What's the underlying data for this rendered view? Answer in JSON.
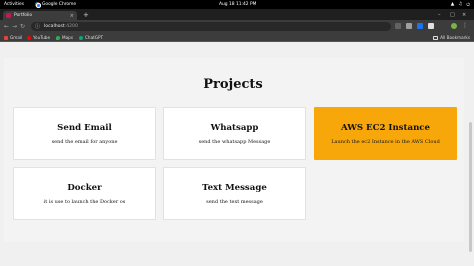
{
  "system": {
    "activities": "Activities",
    "app_name": "Google Chrome",
    "clock": "Aug 18  11:42 PM"
  },
  "browser": {
    "tab": {
      "title": "Portfolio"
    },
    "url": {
      "host": "localhost",
      "port": ":4200"
    },
    "bookmarks": [
      {
        "label": "Gmail",
        "color": "#ea4335"
      },
      {
        "label": "YouTube",
        "color": "#ff0000"
      },
      {
        "label": "Maps",
        "color": "#34a853"
      },
      {
        "label": "ChatGPT",
        "color": "#10a37f"
      }
    ],
    "all_bookmarks": "All Bookmarks"
  },
  "page": {
    "section_title": "Projects",
    "projects": [
      {
        "title": "Send Email",
        "description": "send the email for anyone"
      },
      {
        "title": "Whatsapp",
        "description": "send the whatsapp Message"
      },
      {
        "title": "AWS EC2 Instance",
        "description": "Launch the ec2 Instance in the AWS Cloud"
      },
      {
        "title": "Docker",
        "description": "it is use to launch the Docker os"
      },
      {
        "title": "Text Message",
        "description": "send the text message"
      }
    ],
    "highlight_color": "#f8a70a"
  }
}
